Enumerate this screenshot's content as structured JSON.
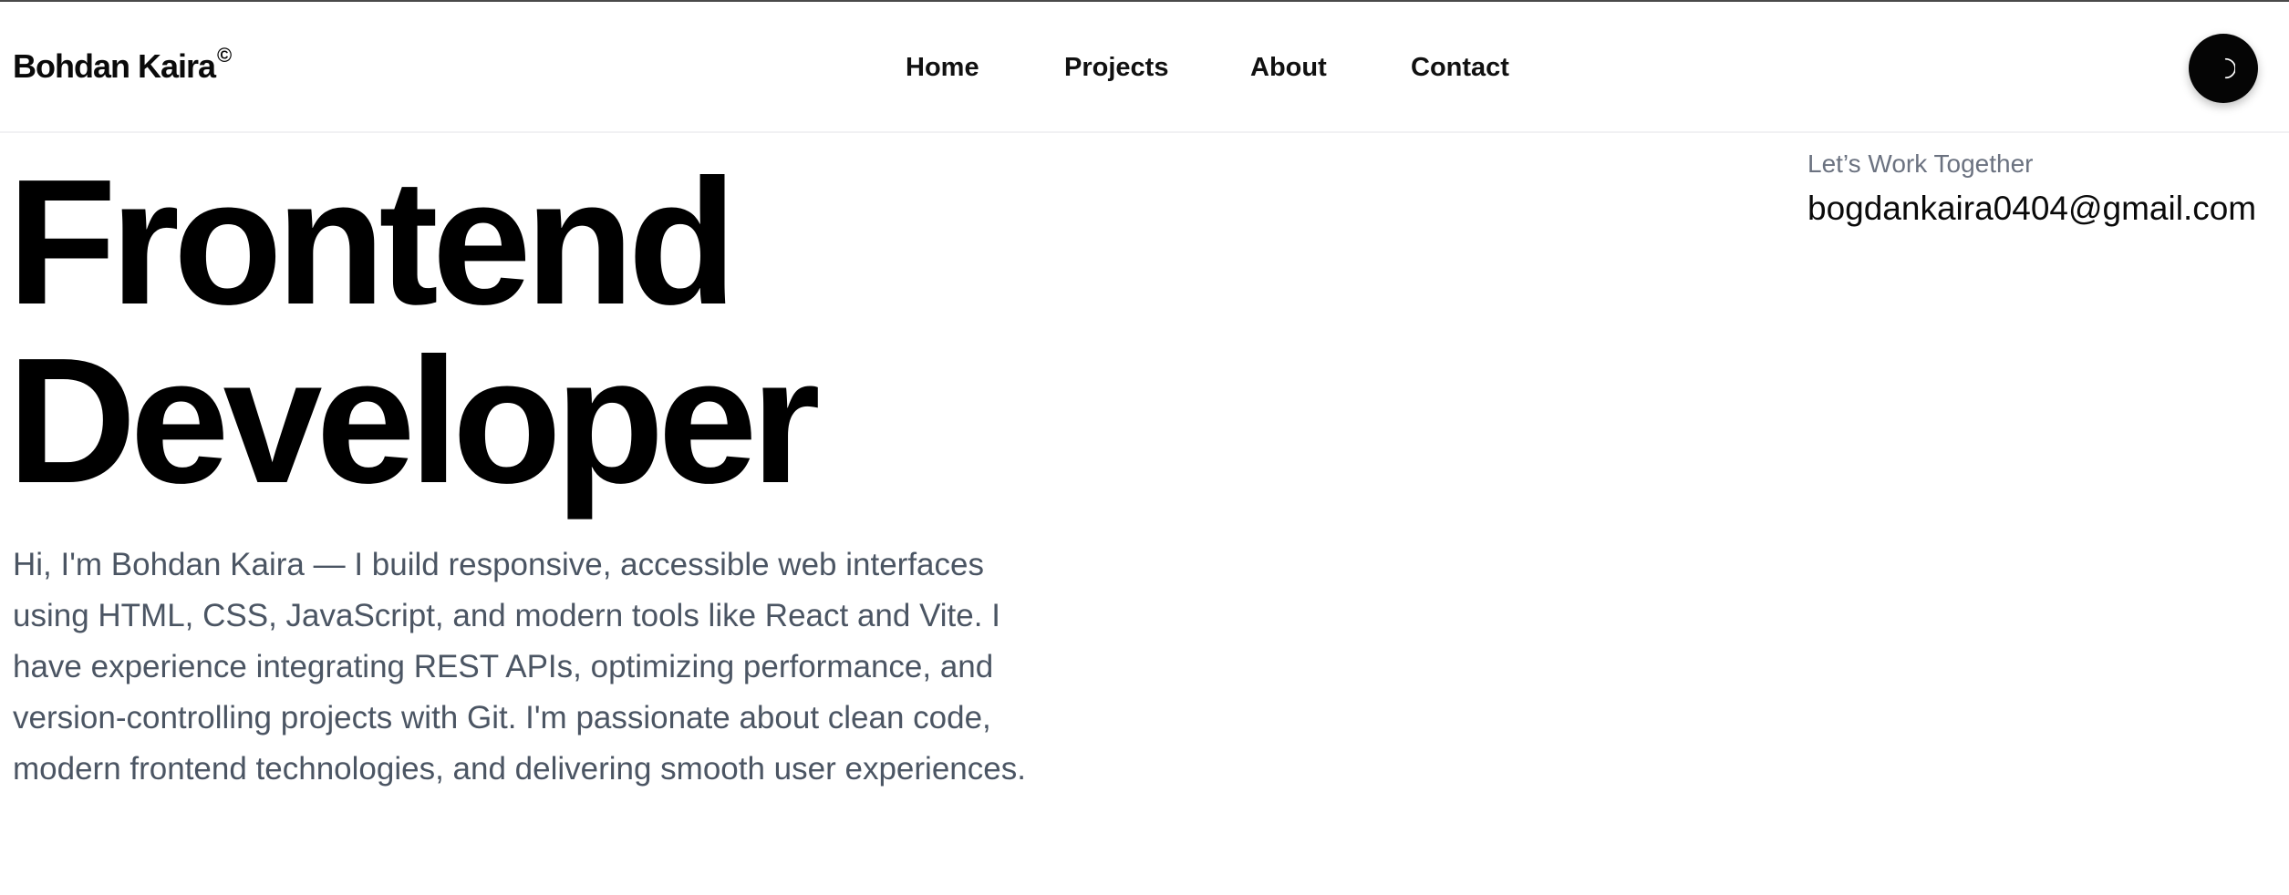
{
  "header": {
    "logo_text": "Bohdan Kaira",
    "logo_mark": "©",
    "nav": [
      {
        "label": "Home"
      },
      {
        "label": "Projects"
      },
      {
        "label": "About"
      },
      {
        "label": "Contact"
      }
    ],
    "theme_toggle_icon": "moon-icon",
    "theme_toggle_color": "#050505"
  },
  "hero": {
    "title_line1": "Frontend",
    "title_line2": "Developer",
    "intro": "Hi, I'm Bohdan Kaira — I build responsive, accessible web interfaces using HTML, CSS, JavaScript, and modern tools like React and Vite. I have experience integrating REST APIs, optimizing performance, and version-controlling projects with Git. I'm passionate about clean code, modern frontend technologies, and delivering smooth user experiences."
  },
  "contact": {
    "label": "Let’s Work Together",
    "email": "bogdankaira0404@gmail.com"
  },
  "colors": {
    "text_primary": "#0a0a0a",
    "text_muted": "#4b5563",
    "label_gray": "#6b7280"
  }
}
